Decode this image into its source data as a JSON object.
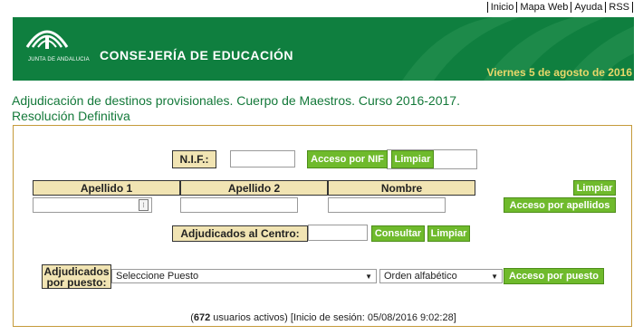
{
  "topnav": {
    "items": [
      "Inicio",
      "Mapa Web",
      "Ayuda",
      "RSS"
    ]
  },
  "header": {
    "logo_text": "JUNTA DE ANDALUCIA",
    "org": "CONSEJERÍA DE EDUCACIÓN",
    "date": "Viernes 5 de agosto de 2016"
  },
  "page": {
    "title_line1": "Adjudicación de destinos provisionales. Cuerpo de Maestros. Curso 2016-2017.",
    "title_line2": "Resolución Definitiva"
  },
  "nif": {
    "label": "N.I.F.:",
    "value": "",
    "button": "Acceso por NIF",
    "clear": "Limpiar"
  },
  "name_search": {
    "headers": [
      "Apellido 1",
      "Apellido 2",
      "Nombre"
    ],
    "values": [
      "",
      "",
      ""
    ],
    "clear": "Limpiar",
    "button": "Acceso por apellidos"
  },
  "centro": {
    "label": "Adjudicados al Centro:",
    "value": "",
    "button": "Consultar",
    "clear": "Limpiar"
  },
  "puesto": {
    "label_line1": "Adjudicados",
    "label_line2": "por puesto:",
    "select_value": "Seleccione Puesto",
    "order_value": "Orden alfabético",
    "button": "Acceso por puesto"
  },
  "status": {
    "open": "(",
    "count": "672",
    "text": " usuarios activos) [Inicio de sesión: 05/08/2016 9:02:28]"
  },
  "colors": {
    "brand_green": "#0f7f3f",
    "button_green": "#6fba2c",
    "label_bg": "#f1e4b3",
    "date_yellow": "#e9d86a",
    "panel_border": "#c59a3a"
  }
}
